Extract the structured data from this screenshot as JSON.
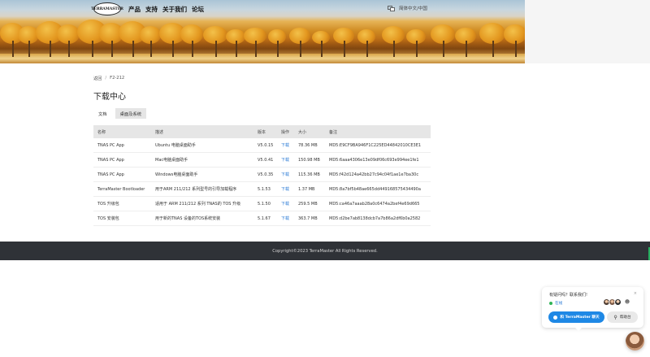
{
  "header": {
    "logo_text": "TERRAMASTER",
    "nav": [
      "产品",
      "支持",
      "关于我们",
      "论坛"
    ],
    "language": "简体中文/中国"
  },
  "breadcrumb": {
    "back": "返回",
    "separator": "/",
    "current": "F2-212"
  },
  "page_title": "下载中心",
  "tabs": [
    {
      "label": "文档",
      "active": false
    },
    {
      "label": "桌面及系统",
      "active": true
    }
  ],
  "table": {
    "headers": [
      "名称",
      "描述",
      "版本",
      "操作",
      "大小",
      "备注"
    ],
    "rows": [
      {
        "name": "TNAS PC App",
        "desc": "Ubuntu 电脑桌面助手",
        "version": "V5.0.15",
        "action": "下载",
        "size": "78.36 MB",
        "note": "MD5:E9CF9BA946F1C225ED44842010CE3E1"
      },
      {
        "name": "TNAS PC App",
        "desc": "Mac电脑桌面助手",
        "version": "V5.0.41",
        "action": "下载",
        "size": "150.98 MB",
        "note": "MD5:6aaa4306e13e09df06c693e994ee1fe1"
      },
      {
        "name": "TNAS PC App",
        "desc": "Windows电脑桌面助手",
        "version": "V5.0.35",
        "action": "下载",
        "size": "115.36 MB",
        "note": "MD5:f42d124a42bb27c94c04f1ae1e7ba30c"
      },
      {
        "name": "TerraMaster Bootloader",
        "desc": "用于ARM 211/212 系列型号的引导加载程序",
        "version": "5.1.53",
        "action": "下载",
        "size": "1.37 MB",
        "note": "MD5:8a7bf5b48ae665dd44916857543449​0a"
      },
      {
        "name": "TOS 升级包",
        "desc": "适用于 ARM 211/212 系列 TNAS的 TOS 升级",
        "version": "5.1.50",
        "action": "下载",
        "size": "259.5 MB",
        "note": "MD5:ca46a7aaab28a0c6474a2bef4e69d665"
      },
      {
        "name": "TOS 安装包",
        "desc": "用于新的TNAS 设备的TOS系统安装",
        "version": "5.1.67",
        "action": "下载",
        "size": "363.7 MB",
        "note": "MD5:d2be7ab8138dcb7a7b86a2df6b0a2582"
      }
    ]
  },
  "footer": {
    "copyright": "Copyright©2023 TerraMaster All Rights Reserved."
  },
  "chat": {
    "question": "有疑问吗？联系我们!",
    "close": "×",
    "status": "在线",
    "chat_button": "和 TerraMaster 聊天",
    "help_button": "帮助台"
  },
  "colors": {
    "accent": "#1e88e5",
    "link": "#2b7bd6",
    "footer_bg": "#2f3237",
    "online": "#2fb457"
  }
}
